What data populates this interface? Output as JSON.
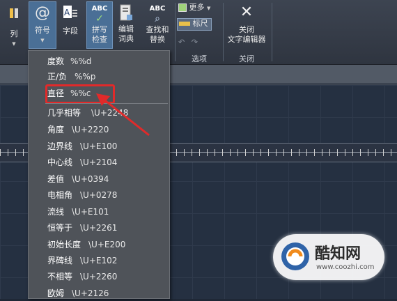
{
  "ribbon": {
    "col_label": "列",
    "symbol_label": "符号",
    "field_label": "字段",
    "spell_label1": "拼写",
    "spell_label2": "检查",
    "spell_icon_text": "ABC",
    "dict_label1": "编辑",
    "dict_label2": "词典",
    "find_label1": "查找和",
    "find_label2": "替换",
    "find_icon_text": "ABC",
    "more_label": "更多",
    "ruler_label": "标尺",
    "options_title": "选项",
    "close_label1": "关闭",
    "close_label2": "文字编辑器",
    "close_title": "关闭"
  },
  "menu": {
    "items": [
      {
        "name": "度数",
        "code": "%%d"
      },
      {
        "name": "正/负",
        "code": "%%p"
      },
      {
        "name": "直径",
        "code": "%%c"
      },
      {
        "name": "几乎相等",
        "code": "\\U+2248"
      },
      {
        "name": "角度",
        "code": "\\U+2220"
      },
      {
        "name": "边界线",
        "code": "\\U+E100"
      },
      {
        "name": "中心线",
        "code": "\\U+2104"
      },
      {
        "name": "差值",
        "code": "\\U+0394"
      },
      {
        "name": "电相角",
        "code": "\\U+0278"
      },
      {
        "name": "流线",
        "code": "\\U+E101"
      },
      {
        "name": "恒等于",
        "code": "\\U+2261"
      },
      {
        "name": "初始长度",
        "code": "\\U+E200"
      },
      {
        "name": "界碑线",
        "code": "\\U+E102"
      },
      {
        "name": "不相等",
        "code": "\\U+2260"
      },
      {
        "name": "欧姆",
        "code": "\\U+2126"
      }
    ]
  },
  "watermark": {
    "brand": "酷知网",
    "url": "www.coozhi.com"
  },
  "colors": {
    "highlight": "#e12a2a",
    "active_button": "#4a6f96"
  }
}
